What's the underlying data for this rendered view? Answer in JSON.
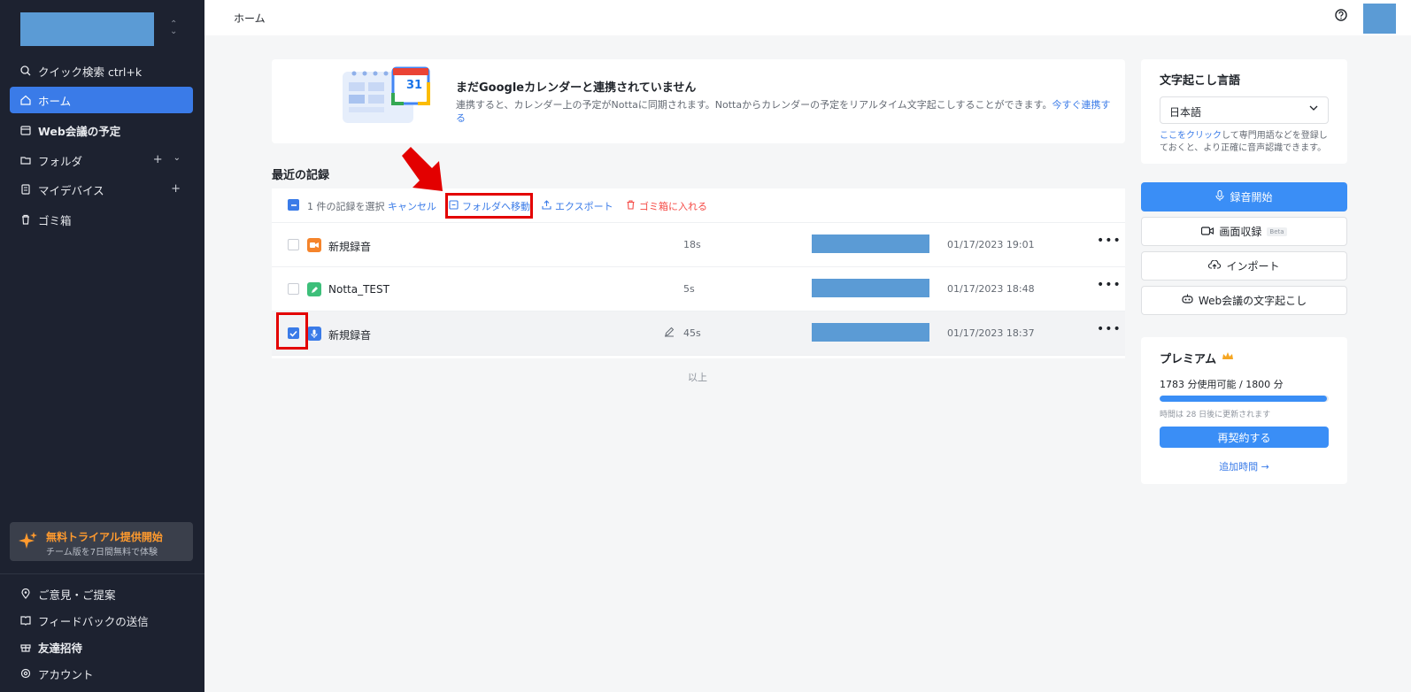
{
  "sidebar": {
    "items": [
      {
        "label": "クイック検索 ctrl+k"
      },
      {
        "label": "ホーム"
      },
      {
        "label": "Web会議の予定"
      },
      {
        "label": "フォルダ"
      },
      {
        "label": "マイデバイス"
      },
      {
        "label": "ゴミ箱"
      }
    ],
    "trial": {
      "title": "無料トライアル提供開始",
      "subtitle": "チーム版を7日間無料で体験"
    },
    "bottom": [
      {
        "label": "ご意見・ご提案"
      },
      {
        "label": "フィードバックの送信"
      },
      {
        "label": "友達招待"
      },
      {
        "label": "アカウント"
      }
    ]
  },
  "header": {
    "breadcrumb": "ホーム"
  },
  "banner": {
    "title": "まだGoogleカレンダーと連携されていません",
    "desc": "連携すると、カレンダー上の予定がNottaに同期されます。Nottaからカレンダーの予定をリアルタイム文字起こしすることができます。",
    "link": "今すぐ連携する",
    "calendar_day": "31"
  },
  "records": {
    "title": "最近の記録",
    "toolbar": {
      "selected": "1 件の記録を選択",
      "cancel": "キャンセル",
      "move": "フォルダへ移動",
      "export": "エクスポート",
      "trash": "ゴミ箱に入れる"
    },
    "rows": [
      {
        "name": "新規録音",
        "duration": "18s",
        "date": "01/17/2023 19:01",
        "icon_color": "#f5842b",
        "checked": false
      },
      {
        "name": "Notta_TEST",
        "duration": "5s",
        "date": "01/17/2023 18:48",
        "icon_color": "#3dbf7a",
        "checked": false
      },
      {
        "name": "新規録音",
        "duration": "45s",
        "date": "01/17/2023 18:37",
        "icon_color": "#3a7be8",
        "checked": true
      }
    ],
    "end": "以上"
  },
  "lang_card": {
    "title": "文字起こし言語",
    "selected": "日本語",
    "tip_link": "ここをクリック",
    "tip": "して専門用語などを登録しておくと、より正確に音声認識できます。"
  },
  "actions": {
    "record": "録音開始",
    "screen": "画面収録",
    "beta": "Beta",
    "import": "インポート",
    "web": "Web会議の文字起こし"
  },
  "premium": {
    "title": "プレミアム",
    "usage": "1783 分使用可能 / 1800 分",
    "usage_fraction": 0.99,
    "renew": "時間は 28 日後に更新されます",
    "button": "再契約する",
    "add": "追加時間 →"
  },
  "colors": {
    "accent": "#3a8ef6",
    "sidebar_bg": "#1d2230",
    "annotation": "#e30000"
  }
}
